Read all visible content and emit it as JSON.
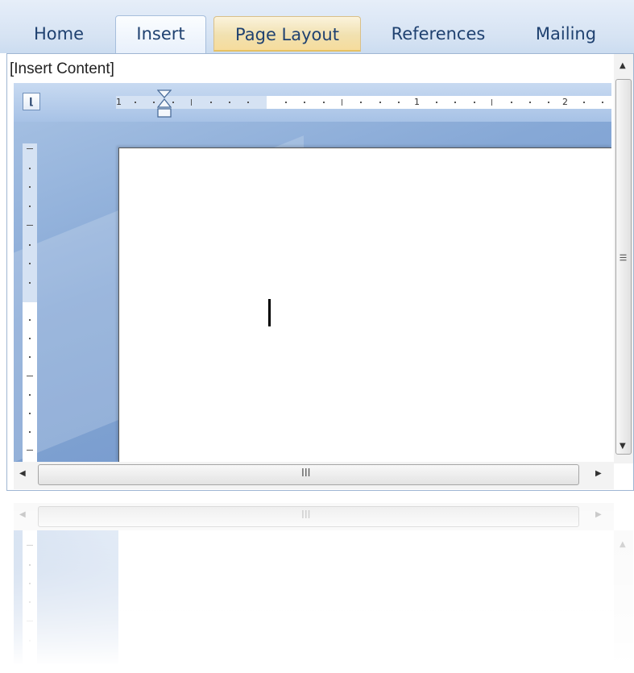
{
  "ribbon": {
    "tabs": [
      {
        "label": "Home"
      },
      {
        "label": "Insert"
      },
      {
        "label": "Page Layout"
      },
      {
        "label": "References"
      },
      {
        "label": "Mailing"
      }
    ],
    "selected_tab": "Insert",
    "hovered_tab": "Page Layout"
  },
  "document": {
    "label": "[Insert Content]",
    "ruler_numbers": [
      "1",
      "1",
      "2"
    ],
    "tab_selector_glyph": "⌊"
  },
  "scrollbars": {
    "grip_glyph": "III",
    "left_arrow": "◀",
    "right_arrow": "▶",
    "up_arrow": "▲",
    "down_arrow": "▼"
  },
  "colors": {
    "tab_text": "#1f4170",
    "workspace_blue": "#86a8d6",
    "hover_tab": "#f1e1b0"
  }
}
